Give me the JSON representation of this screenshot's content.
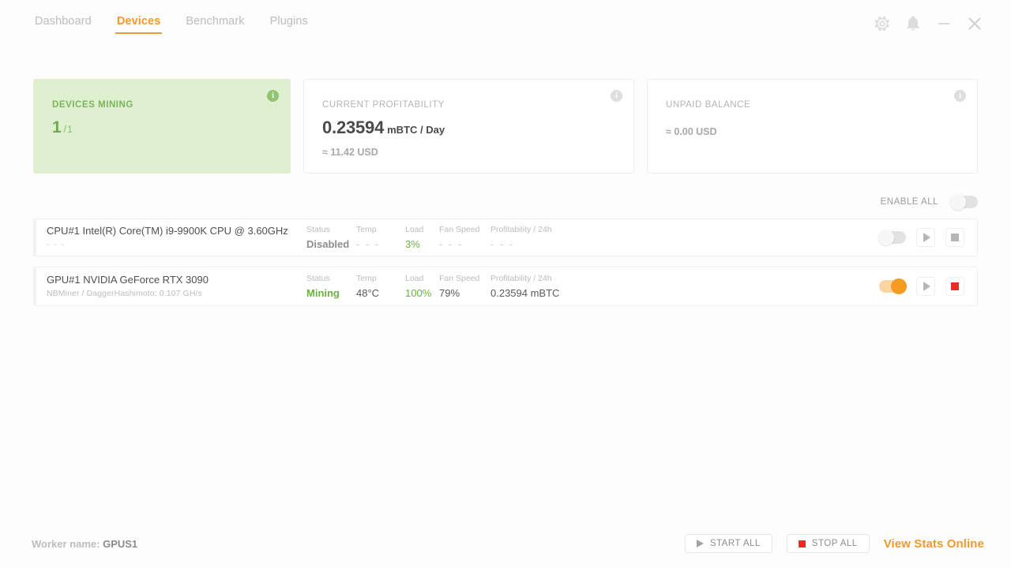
{
  "nav": {
    "tabs": [
      {
        "label": "Dashboard",
        "active": false
      },
      {
        "label": "Devices",
        "active": true
      },
      {
        "label": "Benchmark",
        "active": false
      },
      {
        "label": "Plugins",
        "active": false
      }
    ]
  },
  "window_controls": {
    "settings": "gear-icon",
    "notifications": "bell-icon",
    "minimize": "minimize-icon",
    "close": "close-icon"
  },
  "summary_cards": {
    "devices_mining": {
      "label": "DEVICES MINING",
      "value": "1",
      "separator": "/",
      "total": "1",
      "info": "i"
    },
    "current_profitability": {
      "label": "CURRENT PROFITABILITY",
      "value": "0.23594",
      "unit": "mBTC / Day",
      "sub": "≈ 11.42 USD",
      "info": "i"
    },
    "unpaid_balance": {
      "label": "UNPAID BALANCE",
      "value": "",
      "unit": "",
      "sub": "≈ 0.00 USD",
      "info": "i"
    }
  },
  "enable_all": {
    "label": "ENABLE ALL",
    "enabled": false
  },
  "table_headers": {
    "status": "Status",
    "temp": "Temp",
    "load": "Load",
    "fan_speed": "Fan Speed",
    "profitability": "Profitability / 24h"
  },
  "devices": [
    {
      "name": "CPU#1 Intel(R) Core(TM) i9-9900K CPU @ 3.60GHz",
      "sub": "- - -",
      "status": "Disabled",
      "temp": "- - -",
      "load": "3%",
      "fan_speed": "- - -",
      "profitability": "- - -",
      "enabled": false,
      "start": "start-icon",
      "stop": "stop-icon"
    },
    {
      "name": "GPU#1 NVIDIA GeForce RTX 3090",
      "sub": "NBMiner / DaggerHashimoto: 0.107 GH/s",
      "status": "Mining",
      "temp": "48°C",
      "load": "100%",
      "fan_speed": "79%",
      "profitability": "0.23594 mBTC",
      "enabled": true,
      "start": "start-icon",
      "stop": "stop-icon"
    }
  ],
  "footer": {
    "worker_label": "Worker name:",
    "worker_name": "GPUS1",
    "start_all": "START ALL",
    "stop_all": "STOP ALL",
    "stats_link": "View Stats Online"
  },
  "colors": {
    "accent": "#f2992e",
    "mining_green": "#6bb33f",
    "card_green_bg": "#dff0d0",
    "stop_red": "#ec2c24"
  }
}
